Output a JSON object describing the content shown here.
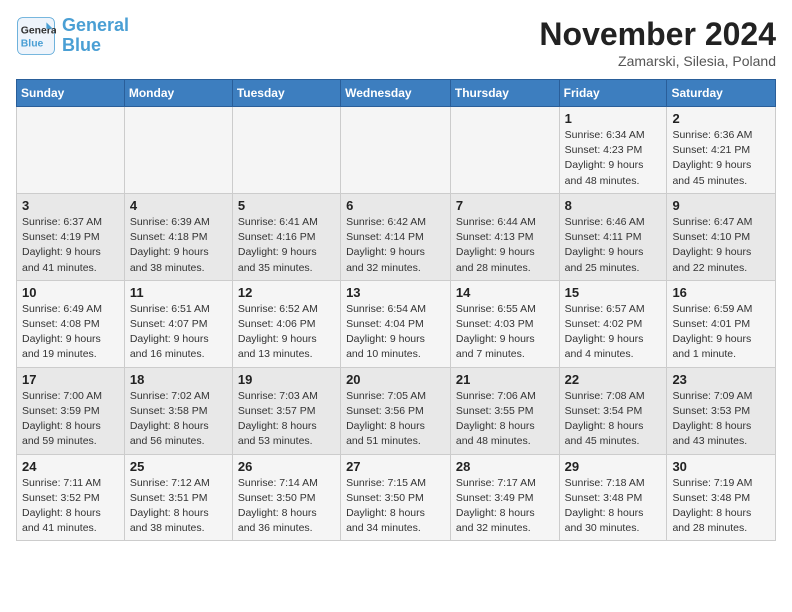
{
  "logo": {
    "line1": "General",
    "line2": "Blue"
  },
  "title": "November 2024",
  "location": "Zamarski, Silesia, Poland",
  "weekdays": [
    "Sunday",
    "Monday",
    "Tuesday",
    "Wednesday",
    "Thursday",
    "Friday",
    "Saturday"
  ],
  "weeks": [
    [
      {
        "day": "",
        "info": ""
      },
      {
        "day": "",
        "info": ""
      },
      {
        "day": "",
        "info": ""
      },
      {
        "day": "",
        "info": ""
      },
      {
        "day": "",
        "info": ""
      },
      {
        "day": "1",
        "info": "Sunrise: 6:34 AM\nSunset: 4:23 PM\nDaylight: 9 hours\nand 48 minutes."
      },
      {
        "day": "2",
        "info": "Sunrise: 6:36 AM\nSunset: 4:21 PM\nDaylight: 9 hours\nand 45 minutes."
      }
    ],
    [
      {
        "day": "3",
        "info": "Sunrise: 6:37 AM\nSunset: 4:19 PM\nDaylight: 9 hours\nand 41 minutes."
      },
      {
        "day": "4",
        "info": "Sunrise: 6:39 AM\nSunset: 4:18 PM\nDaylight: 9 hours\nand 38 minutes."
      },
      {
        "day": "5",
        "info": "Sunrise: 6:41 AM\nSunset: 4:16 PM\nDaylight: 9 hours\nand 35 minutes."
      },
      {
        "day": "6",
        "info": "Sunrise: 6:42 AM\nSunset: 4:14 PM\nDaylight: 9 hours\nand 32 minutes."
      },
      {
        "day": "7",
        "info": "Sunrise: 6:44 AM\nSunset: 4:13 PM\nDaylight: 9 hours\nand 28 minutes."
      },
      {
        "day": "8",
        "info": "Sunrise: 6:46 AM\nSunset: 4:11 PM\nDaylight: 9 hours\nand 25 minutes."
      },
      {
        "day": "9",
        "info": "Sunrise: 6:47 AM\nSunset: 4:10 PM\nDaylight: 9 hours\nand 22 minutes."
      }
    ],
    [
      {
        "day": "10",
        "info": "Sunrise: 6:49 AM\nSunset: 4:08 PM\nDaylight: 9 hours\nand 19 minutes."
      },
      {
        "day": "11",
        "info": "Sunrise: 6:51 AM\nSunset: 4:07 PM\nDaylight: 9 hours\nand 16 minutes."
      },
      {
        "day": "12",
        "info": "Sunrise: 6:52 AM\nSunset: 4:06 PM\nDaylight: 9 hours\nand 13 minutes."
      },
      {
        "day": "13",
        "info": "Sunrise: 6:54 AM\nSunset: 4:04 PM\nDaylight: 9 hours\nand 10 minutes."
      },
      {
        "day": "14",
        "info": "Sunrise: 6:55 AM\nSunset: 4:03 PM\nDaylight: 9 hours\nand 7 minutes."
      },
      {
        "day": "15",
        "info": "Sunrise: 6:57 AM\nSunset: 4:02 PM\nDaylight: 9 hours\nand 4 minutes."
      },
      {
        "day": "16",
        "info": "Sunrise: 6:59 AM\nSunset: 4:01 PM\nDaylight: 9 hours\nand 1 minute."
      }
    ],
    [
      {
        "day": "17",
        "info": "Sunrise: 7:00 AM\nSunset: 3:59 PM\nDaylight: 8 hours\nand 59 minutes."
      },
      {
        "day": "18",
        "info": "Sunrise: 7:02 AM\nSunset: 3:58 PM\nDaylight: 8 hours\nand 56 minutes."
      },
      {
        "day": "19",
        "info": "Sunrise: 7:03 AM\nSunset: 3:57 PM\nDaylight: 8 hours\nand 53 minutes."
      },
      {
        "day": "20",
        "info": "Sunrise: 7:05 AM\nSunset: 3:56 PM\nDaylight: 8 hours\nand 51 minutes."
      },
      {
        "day": "21",
        "info": "Sunrise: 7:06 AM\nSunset: 3:55 PM\nDaylight: 8 hours\nand 48 minutes."
      },
      {
        "day": "22",
        "info": "Sunrise: 7:08 AM\nSunset: 3:54 PM\nDaylight: 8 hours\nand 45 minutes."
      },
      {
        "day": "23",
        "info": "Sunrise: 7:09 AM\nSunset: 3:53 PM\nDaylight: 8 hours\nand 43 minutes."
      }
    ],
    [
      {
        "day": "24",
        "info": "Sunrise: 7:11 AM\nSunset: 3:52 PM\nDaylight: 8 hours\nand 41 minutes."
      },
      {
        "day": "25",
        "info": "Sunrise: 7:12 AM\nSunset: 3:51 PM\nDaylight: 8 hours\nand 38 minutes."
      },
      {
        "day": "26",
        "info": "Sunrise: 7:14 AM\nSunset: 3:50 PM\nDaylight: 8 hours\nand 36 minutes."
      },
      {
        "day": "27",
        "info": "Sunrise: 7:15 AM\nSunset: 3:50 PM\nDaylight: 8 hours\nand 34 minutes."
      },
      {
        "day": "28",
        "info": "Sunrise: 7:17 AM\nSunset: 3:49 PM\nDaylight: 8 hours\nand 32 minutes."
      },
      {
        "day": "29",
        "info": "Sunrise: 7:18 AM\nSunset: 3:48 PM\nDaylight: 8 hours\nand 30 minutes."
      },
      {
        "day": "30",
        "info": "Sunrise: 7:19 AM\nSunset: 3:48 PM\nDaylight: 8 hours\nand 28 minutes."
      }
    ]
  ]
}
